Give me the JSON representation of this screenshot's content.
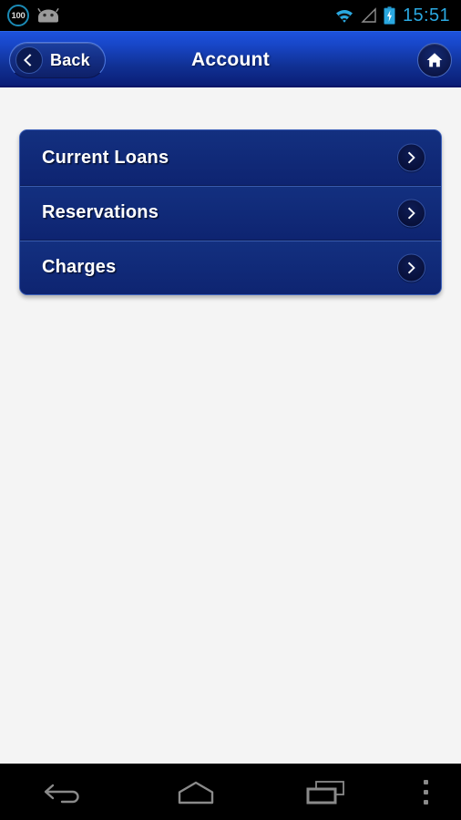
{
  "status_bar": {
    "battery_percent": "100",
    "icons": [
      "battery-percent-badge",
      "android-head-icon",
      "wifi-icon",
      "signal-triangle-icon",
      "battery-charging-icon"
    ],
    "time": "15:51",
    "accent_color": "#2aa8e0",
    "background_color": "#000000"
  },
  "title_bar": {
    "back_label": "Back",
    "title": "Account",
    "home_icon": "home-icon",
    "back_icon": "chevron-left-icon",
    "gradient_top": "#1d52dd",
    "gradient_bottom": "#0a1c74"
  },
  "menu": {
    "items": [
      {
        "label": "Current Loans",
        "chevron": "chevron-right-icon"
      },
      {
        "label": "Reservations",
        "chevron": "chevron-right-icon"
      },
      {
        "label": "Charges",
        "chevron": "chevron-right-icon"
      }
    ],
    "panel_color": "#0f2578",
    "text_color": "#ffffff"
  },
  "nav_bar": {
    "buttons": [
      {
        "name": "back",
        "icon": "nav-back-arrow-icon"
      },
      {
        "name": "home",
        "icon": "nav-home-icon"
      },
      {
        "name": "recents",
        "icon": "nav-recents-icon"
      },
      {
        "name": "menu",
        "icon": "nav-overflow-menu-icon"
      }
    ],
    "icon_color": "#8a8a8a",
    "background_color": "#000000"
  },
  "page": {
    "background_color": "#f4f4f4"
  }
}
